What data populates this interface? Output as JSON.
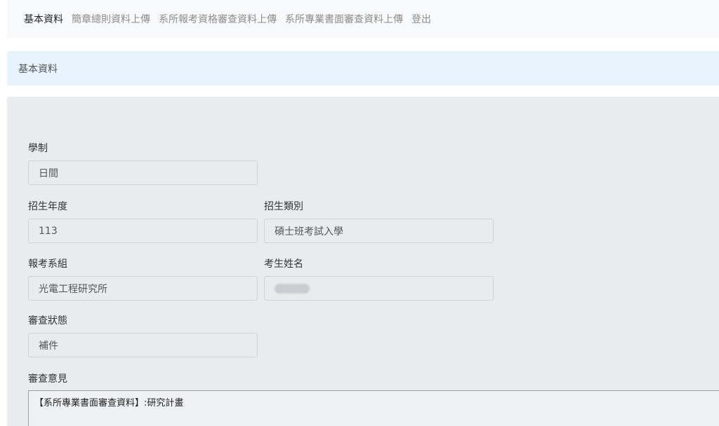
{
  "nav": {
    "items": [
      {
        "label": "基本資料"
      },
      {
        "label": "簡章總則資料上傳"
      },
      {
        "label": "系所報考資格審查資料上傳"
      },
      {
        "label": "系所專業書面審查資料上傳"
      },
      {
        "label": "登出"
      }
    ]
  },
  "header": {
    "title": "基本資料"
  },
  "form": {
    "study_system": {
      "label": "學制",
      "value": "日間"
    },
    "admission_year": {
      "label": "招生年度",
      "value": "113"
    },
    "admission_category": {
      "label": "招生類別",
      "value": "碩士班考試入學"
    },
    "department": {
      "label": "報考系組",
      "value": "光電工程研究所"
    },
    "applicant_name": {
      "label": "考生姓名",
      "value": ""
    },
    "review_status": {
      "label": "審查狀態",
      "value": "補件"
    },
    "review_comments": {
      "label": "審查意見",
      "value": "【系所專業書面審查資料】:研究計畫"
    }
  }
}
